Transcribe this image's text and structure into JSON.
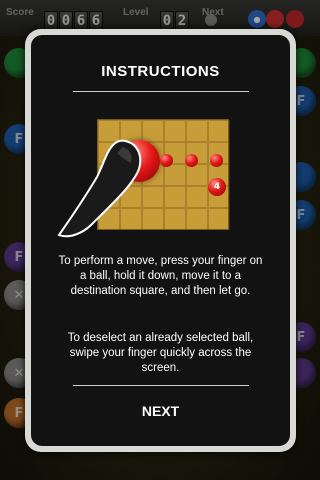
{
  "hud": {
    "score_label": "Score",
    "score_digits": [
      "0",
      "0",
      "6",
      "6"
    ],
    "level_label": "Level",
    "level_digits": [
      "0",
      "2"
    ],
    "next_label": "Next"
  },
  "instructions": {
    "title": "INSTRUCTIONS",
    "demo_ball_number": "4",
    "paragraph_1": "To perform a move, press your finger on a ball, hold it down, move it to a destination square, and then let go.",
    "paragraph_2": "To deselect an already selected ball, swipe your finger quickly across the screen.",
    "next_button": "NEXT"
  },
  "background_ball_letters": [
    "F",
    "F",
    "F",
    "F",
    "F",
    "F"
  ],
  "colors": {
    "ball_green": "#1f8a3a",
    "ball_blue": "#1f5fae",
    "ball_purple": "#5b3a8c",
    "ball_orange": "#c0702a",
    "ball_gray": "#8a8a8a",
    "demo_red": "#e01818",
    "board_gold": "#c79d3a"
  }
}
